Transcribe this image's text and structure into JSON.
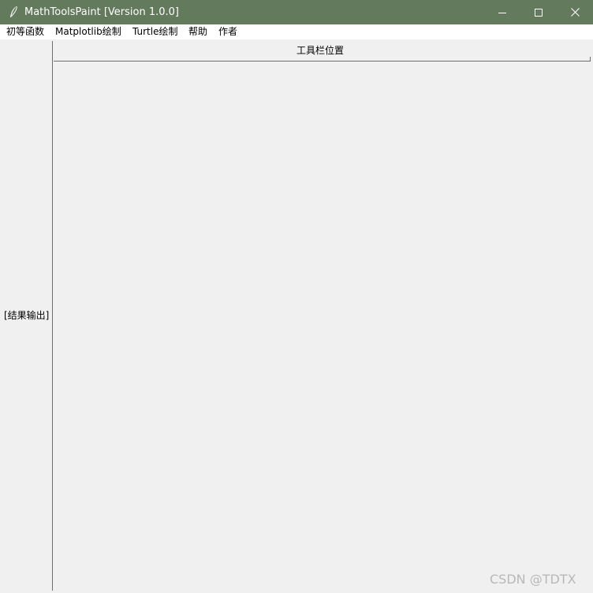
{
  "window": {
    "title": "MathToolsPaint [Version 1.0.0]",
    "icon": "feather-icon",
    "titlebar_color": "#637a5d",
    "controls": [
      "minimize-icon",
      "maximize-icon",
      "close-icon"
    ]
  },
  "menubar": {
    "items": [
      {
        "label": "初等函数"
      },
      {
        "label": "Matplotlib绘制"
      },
      {
        "label": "Turtle绘制"
      },
      {
        "label": "帮助"
      },
      {
        "label": "作者"
      }
    ]
  },
  "result_panel": {
    "label": "[结果输出]"
  },
  "toolbar": {
    "label": "工具栏位置"
  },
  "watermark": {
    "text": "CSDN @TDTX"
  }
}
